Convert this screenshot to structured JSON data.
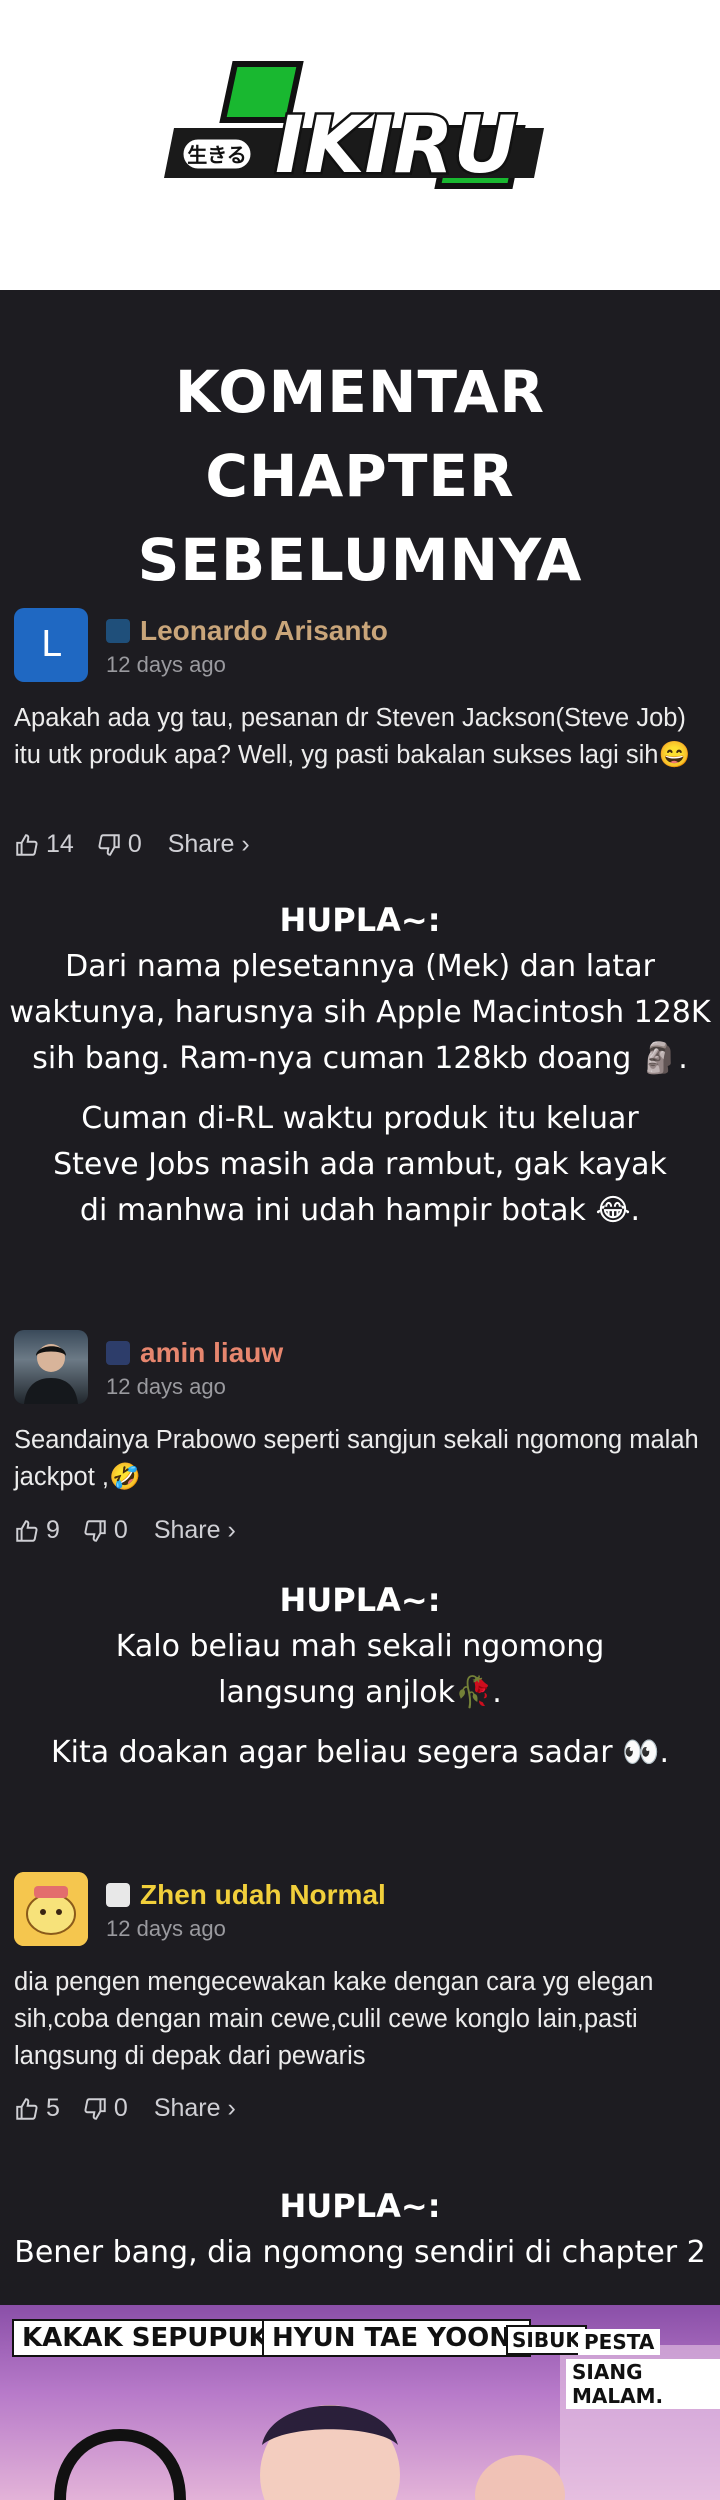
{
  "logo": {
    "kanji": "生きる",
    "word": "IKIRU"
  },
  "section_title": {
    "line1": "KOMENTAR",
    "line2": "CHAPTER SEBELUMNYA"
  },
  "comments": [
    {
      "avatar_letter": "L",
      "name": "Leonardo Arisanto",
      "name_color": "#c9a57a",
      "time": "12 days ago",
      "text": "Apakah ada yg tau, pesanan dr Steven Jackson(Steve Job) itu utk produk apa? Well, yg pasti bakalan sukses lagi sih😄",
      "likes": "14",
      "dislikes": "0",
      "share": "Share ›"
    },
    {
      "name": "amin liauw",
      "name_color": "#e7866e",
      "time": "12 days ago",
      "text": "Seandainya Prabowo seperti sangjun sekali ngomong malah jackpot ,🤣",
      "likes": "9",
      "dislikes": "0",
      "share": "Share ›"
    },
    {
      "name": "Zhen udah Normal",
      "name_color": "#f1cf3b",
      "time": "12 days ago",
      "text": "dia pengen mengecewakan kake dengan cara yg elegan sih,coba dengan main cewe,culil cewe konglo lain,pasti langsung di depak dari pewaris",
      "likes": "5",
      "dislikes": "0",
      "share": "Share ›"
    }
  ],
  "replies": [
    {
      "head": "HUPLA~:",
      "p1": [
        "Dari nama plesetannya (Mek) dan latar",
        "waktunya, harusnya sih Apple Macintosh 128K",
        "sih bang. Ram-nya cuman 128kb doang 🗿."
      ],
      "p2": [
        "Cuman di-RL waktu produk itu keluar",
        "Steve Jobs masih ada rambut, gak kayak",
        "di manhwa ini udah hampir botak 😂."
      ]
    },
    {
      "head": "HUPLA~:",
      "p1": [
        "Kalo beliau mah sekali ngomong",
        "langsung anjlok🥀."
      ],
      "p2": [
        "Kita doakan agar beliau segera sadar 👀."
      ]
    },
    {
      "head": "HUPLA~:",
      "p1": [
        "Bener bang, dia ngomong sendiri di chapter 2"
      ],
      "p2": []
    }
  ],
  "manga": {
    "cap1": "KAKAK SEPUPUKU,",
    "cap2": "HYUN TAE YOON,",
    "cap3": "SIBUK",
    "cap4": "PESTA",
    "cap5": "SIANG MALAM."
  },
  "icon_names": [
    "thumbs-up-icon",
    "thumbs-down-icon"
  ]
}
